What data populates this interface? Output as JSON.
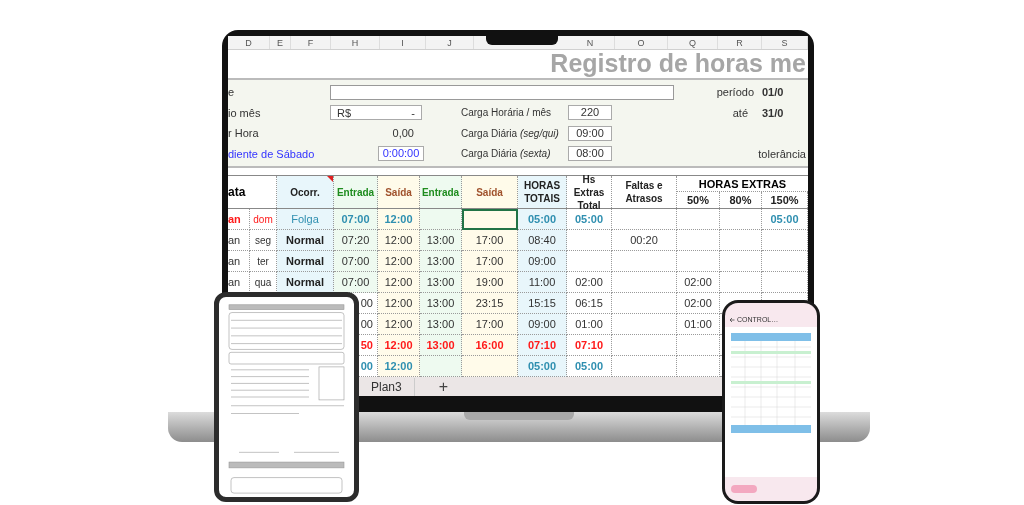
{
  "sheet": {
    "column_letters": [
      "D",
      "E",
      "F",
      "H",
      "I",
      "J",
      "N",
      "O",
      "Q",
      "R",
      "S"
    ],
    "title": "Registro de horas me",
    "info": {
      "employee_label": "e",
      "salary_label": "io mês",
      "salary_currency": "R$",
      "salary_value": "-",
      "hour_label": "r Hora",
      "hour_value": "0,00",
      "saturday_label": "diente de Sábado",
      "saturday_value": "0:00:00",
      "loads": [
        {
          "label": "Carga Horária / mês",
          "value": "220"
        },
        {
          "label": "Carga Diária *(seg/qui)*",
          "value": "09:00"
        },
        {
          "label": "Carga Diária *(sexta)*",
          "value": "08:00"
        }
      ],
      "period_label": "período",
      "period_start": "01/0",
      "period_end_label": "até",
      "period_end": "31/0",
      "tolerance_label": "tolerância"
    },
    "header": {
      "date": "ata",
      "columns": [
        {
          "label": "Ocorr.",
          "kind": "status",
          "comment": true
        },
        {
          "label": "Entrada",
          "kind": "in",
          "comment": false
        },
        {
          "label": "Saída",
          "kind": "out",
          "comment": false
        },
        {
          "label": "Entrada",
          "kind": "in",
          "comment": false
        },
        {
          "label": "Saída",
          "kind": "out",
          "comment": false
        },
        {
          "label": "HORAS TOTAIS",
          "kind": "total",
          "comment": false
        },
        {
          "label": "Hs Extras Total",
          "kind": "plain",
          "comment": false
        },
        {
          "label": "Faltas e Atrasos",
          "kind": "plain",
          "comment": false
        }
      ],
      "group": {
        "label": "HORAS EXTRAS",
        "columns": [
          "50%",
          "80%",
          "150%"
        ]
      }
    },
    "rows": [
      {
        "kind": "off",
        "day": "an",
        "weekday": "dom",
        "cells": [
          "Folga",
          "07:00",
          "12:00",
          null,
          {
            "text": null,
            "selected": true
          },
          "05:00",
          "05:00",
          null,
          null,
          null,
          "05:00"
        ]
      },
      {
        "kind": "normal",
        "day": "an",
        "weekday": "seg",
        "cells": [
          "Normal",
          "07:20",
          "12:00",
          "13:00",
          "17:00",
          "08:40",
          null,
          "00:20",
          null,
          null,
          null
        ]
      },
      {
        "kind": "normal",
        "day": "an",
        "weekday": "ter",
        "cells": [
          "Normal",
          "07:00",
          "12:00",
          "13:00",
          "17:00",
          "09:00",
          null,
          null,
          null,
          null,
          null
        ]
      },
      {
        "kind": "normal",
        "day": "an",
        "weekday": "qua",
        "cells": [
          "Normal",
          "07:00",
          "12:00",
          "13:00",
          "19:00",
          "11:00",
          "02:00",
          null,
          "02:00",
          null,
          null
        ]
      },
      {
        "kind": "normal",
        "cells": [
          null,
          {
            "text": "00",
            "clipped": true
          },
          "12:00",
          "13:00",
          "23:15",
          "15:15",
          "06:15",
          null,
          "02:00",
          null,
          null
        ]
      },
      {
        "kind": "normal",
        "cells": [
          null,
          {
            "text": "00",
            "clipped": true
          },
          "12:00",
          "13:00",
          "17:00",
          "09:00",
          "01:00",
          null,
          "01:00",
          null,
          null
        ]
      },
      {
        "kind": "late",
        "cells": [
          null,
          {
            "text": "50",
            "clipped": true
          },
          "12:00",
          "13:00",
          "16:00",
          "07:10",
          "07:10",
          null,
          null,
          null,
          null
        ]
      },
      {
        "kind": "off",
        "cells": [
          null,
          {
            "text": "00",
            "clipped": true
          },
          "12:00",
          null,
          null,
          "05:00",
          "05:00",
          null,
          null,
          null,
          null
        ]
      }
    ],
    "sheet_tabs": [
      "Plan3"
    ],
    "add_sheet": "+"
  },
  "phone": {
    "title": "CONTROL…"
  }
}
